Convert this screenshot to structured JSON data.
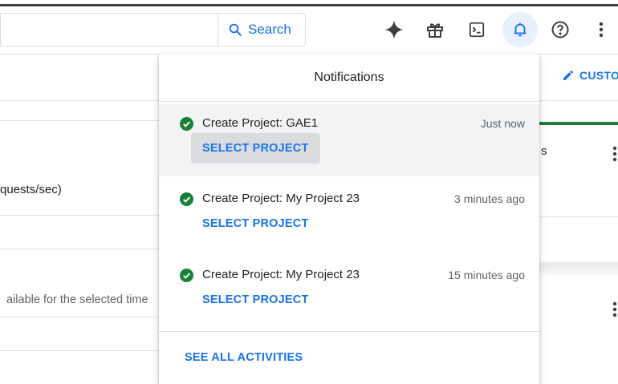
{
  "header": {
    "search_placeholder": "",
    "search_button_label": "Search",
    "icons": [
      "gemini-sparkle-icon",
      "gift-icon",
      "cloud-shell-icon",
      "notifications-bell-icon",
      "help-icon",
      "more-vert-icon"
    ]
  },
  "background": {
    "customize_label": "CUSTO",
    "requests_label": "quests/sec)",
    "availability_text": "ailable for the selected time",
    "partial_char": "s"
  },
  "notifications": {
    "title": "Notifications",
    "items": [
      {
        "title": "Create Project: GAE1",
        "time": "Just now",
        "action": "SELECT PROJECT"
      },
      {
        "title": "Create Project: My Project 23",
        "time": "3 minutes ago",
        "action": "SELECT PROJECT"
      },
      {
        "title": "Create Project: My Project 23",
        "time": "15 minutes ago",
        "action": "SELECT PROJECT"
      }
    ],
    "see_all_label": "SEE ALL ACTIVITIES"
  },
  "colors": {
    "accent": "#1a73e8",
    "success": "#188038",
    "highlight": "#f1f3f4",
    "bell_active_bg": "#e8f0fe"
  }
}
